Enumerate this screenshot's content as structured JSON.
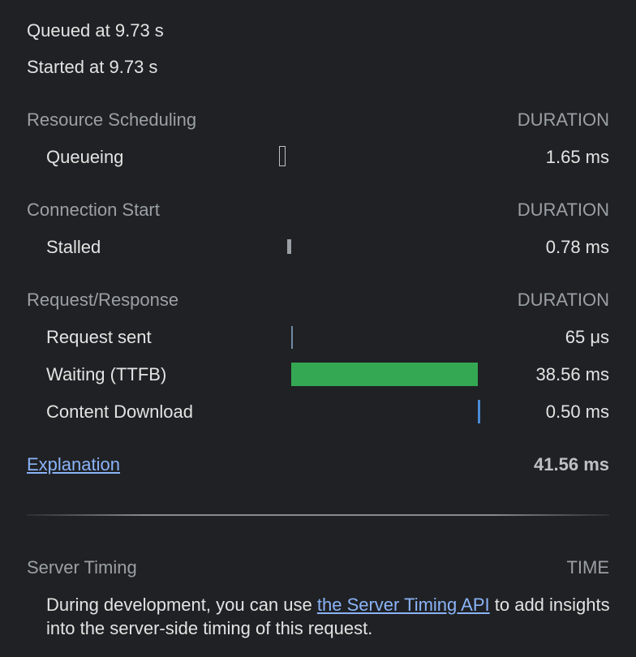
{
  "timing": {
    "queued_at": "Queued at 9.73 s",
    "started_at": "Started at 9.73 s"
  },
  "sections": {
    "resource_scheduling": {
      "title": "Resource Scheduling",
      "duration_header": "DURATION",
      "rows": [
        {
          "label": "Queueing",
          "value": "1.65 ms"
        }
      ]
    },
    "connection_start": {
      "title": "Connection Start",
      "duration_header": "DURATION",
      "rows": [
        {
          "label": "Stalled",
          "value": "0.78 ms"
        }
      ]
    },
    "request_response": {
      "title": "Request/Response",
      "duration_header": "DURATION",
      "rows": [
        {
          "label": "Request sent",
          "value": "65 μs"
        },
        {
          "label": "Waiting (TTFB)",
          "value": "38.56 ms"
        },
        {
          "label": "Content Download",
          "value": "0.50 ms"
        }
      ]
    }
  },
  "footer": {
    "explanation_link": "Explanation",
    "total": "41.56 ms"
  },
  "server_timing": {
    "title": "Server Timing",
    "time_header": "TIME",
    "text_before": "During development, you can use ",
    "link_text": "the Server Timing API",
    "text_after": " to add insights into the server-side timing of this request."
  },
  "colors": {
    "background": "#202124",
    "waiting_bar": "#34a853",
    "download_bar": "#4a8bd6",
    "stalled_bar": "#9aa0a6",
    "link": "#8ab4f8"
  }
}
